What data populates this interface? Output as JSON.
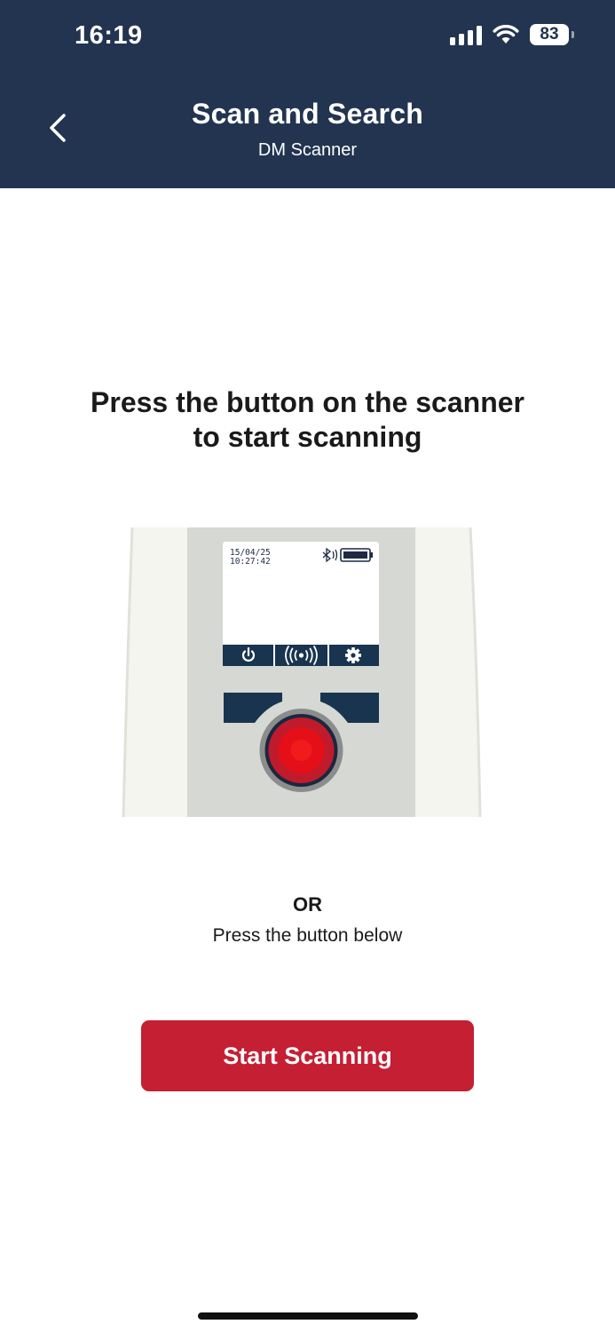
{
  "status_bar": {
    "time": "16:19",
    "battery_level": "83"
  },
  "header": {
    "title": "Scan and Search",
    "subtitle": "DM Scanner",
    "back_icon": "chevron-left-icon"
  },
  "main": {
    "instruction_line1": "Press the button on the scanner",
    "instruction_line2": "to start scanning",
    "scanner_illustration": {
      "date": "15/04/25",
      "time": "10:27:42",
      "screen_icons": [
        "bluetooth-icon",
        "battery-icon"
      ],
      "softkey_icons": [
        "power-icon",
        "broadcast-icon",
        "gear-icon"
      ]
    },
    "or_label": "OR",
    "secondary_instruction": "Press the button below",
    "start_button_label": "Start Scanning"
  },
  "colors": {
    "header_bg": "#22344f",
    "accent": "#c41f33",
    "scanner_key": "#18344f",
    "scan_button": "#e50f19"
  }
}
